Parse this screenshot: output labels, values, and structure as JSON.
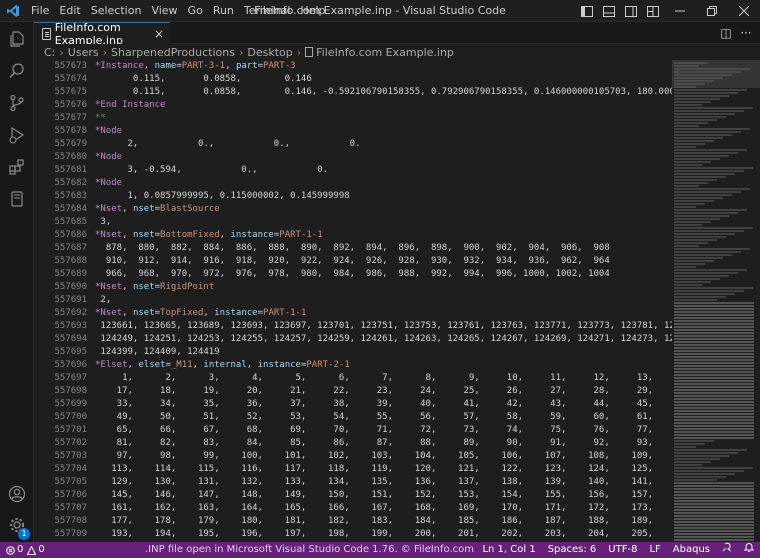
{
  "window": {
    "title": "FileInfo.com Example.inp - Visual Studio Code"
  },
  "menu": [
    "File",
    "Edit",
    "Selection",
    "View",
    "Go",
    "Run",
    "Terminal",
    "Help"
  ],
  "tab": {
    "label": "FileInfo.com Example.inp",
    "close": "×"
  },
  "tab_actions": {
    "split": "◫",
    "more": "···"
  },
  "breadcrumb": [
    "C:",
    "Users",
    "SharpenedProductions",
    "Desktop",
    "FileInfo.com Example.inp"
  ],
  "editor": {
    "lines": [
      {
        "n": "557673",
        "segs": [
          [
            "kw",
            "*Instance"
          ],
          [
            "t",
            ", "
          ],
          [
            "prm",
            "name"
          ],
          [
            "t",
            "="
          ],
          [
            "val",
            "PART-3-1"
          ],
          [
            "t",
            ", "
          ],
          [
            "prm",
            "part"
          ],
          [
            "t",
            "="
          ],
          [
            "val",
            "PART-3"
          ]
        ]
      },
      {
        "n": "557674",
        "segs": [
          [
            "t",
            "       0.115,       0.0858,        0.146"
          ]
        ]
      },
      {
        "n": "557675",
        "segs": [
          [
            "t",
            "       0.115,       0.0858,        0.146, -0.592106790158355, 0.792906790158355, 0.146000000105703, 180.000000"
          ]
        ]
      },
      {
        "n": "557676",
        "segs": [
          [
            "kw",
            "*End Instance"
          ]
        ]
      },
      {
        "n": "557677",
        "segs": [
          [
            "cmt",
            "**"
          ]
        ]
      },
      {
        "n": "557678",
        "segs": [
          [
            "kw",
            "*Node"
          ]
        ]
      },
      {
        "n": "557679",
        "segs": [
          [
            "t",
            "      2,           0.,           0.,           0."
          ]
        ]
      },
      {
        "n": "557680",
        "segs": [
          [
            "kw",
            "*Node"
          ]
        ]
      },
      {
        "n": "557681",
        "segs": [
          [
            "t",
            "      3, -0.594,           0.,           0."
          ]
        ]
      },
      {
        "n": "557682",
        "segs": [
          [
            "kw",
            "*Node"
          ]
        ]
      },
      {
        "n": "557683",
        "segs": [
          [
            "t",
            "      1, 0.0857999995, 0.115000002, 0.145999998"
          ]
        ]
      },
      {
        "n": "557684",
        "segs": [
          [
            "kw",
            "*Nset"
          ],
          [
            "t",
            ", "
          ],
          [
            "prm",
            "nset"
          ],
          [
            "t",
            "="
          ],
          [
            "val",
            "BlastSource"
          ]
        ]
      },
      {
        "n": "557685",
        "segs": [
          [
            "t",
            " 3,"
          ]
        ]
      },
      {
        "n": "557686",
        "segs": [
          [
            "kw",
            "*Nset"
          ],
          [
            "t",
            ", "
          ],
          [
            "prm",
            "nset"
          ],
          [
            "t",
            "="
          ],
          [
            "val",
            "BottomFixed"
          ],
          [
            "t",
            ", "
          ],
          [
            "prm",
            "instance"
          ],
          [
            "t",
            "="
          ],
          [
            "val",
            "PART-1-1"
          ]
        ]
      },
      {
        "n": "557687",
        "segs": [
          [
            "t",
            "  878,  880,  882,  884,  886,  888,  890,  892,  894,  896,  898,  900,  902,  904,  906,  908"
          ]
        ]
      },
      {
        "n": "557688",
        "segs": [
          [
            "t",
            "  910,  912,  914,  916,  918,  920,  922,  924,  926,  928,  930,  932,  934,  936,  962,  964"
          ]
        ]
      },
      {
        "n": "557689",
        "segs": [
          [
            "t",
            "  966,  968,  970,  972,  976,  978,  980,  984,  986,  988,  992,  994,  996, 1000, 1002, 1004"
          ]
        ]
      },
      {
        "n": "557690",
        "segs": [
          [
            "kw",
            "*Nset"
          ],
          [
            "t",
            ", "
          ],
          [
            "prm",
            "nset"
          ],
          [
            "t",
            "="
          ],
          [
            "val",
            "RigidPoint"
          ]
        ]
      },
      {
        "n": "557691",
        "segs": [
          [
            "t",
            " 2,"
          ]
        ]
      },
      {
        "n": "557692",
        "segs": [
          [
            "kw",
            "*Nset"
          ],
          [
            "t",
            ", "
          ],
          [
            "prm",
            "nset"
          ],
          [
            "t",
            "="
          ],
          [
            "val",
            "TopFixed"
          ],
          [
            "t",
            ", "
          ],
          [
            "prm",
            "instance"
          ],
          [
            "t",
            "="
          ],
          [
            "val",
            "PART-1-1"
          ]
        ]
      },
      {
        "n": "557693",
        "segs": [
          [
            "t",
            " 123661, 123665, 123689, 123693, 123697, 123701, 123751, 123753, 123761, 123763, 123771, 123773, 123781, 12378"
          ]
        ]
      },
      {
        "n": "557694",
        "segs": [
          [
            "t",
            " 124249, 124251, 124253, 124255, 124257, 124259, 124261, 124263, 124265, 124267, 124269, 124271, 124273, 12427"
          ]
        ]
      },
      {
        "n": "557695",
        "segs": [
          [
            "t",
            " 124399, 124409, 124419"
          ]
        ]
      },
      {
        "n": "557696",
        "segs": [
          [
            "kw",
            "*Elset"
          ],
          [
            "t",
            ", "
          ],
          [
            "prm",
            "elset"
          ],
          [
            "t",
            "="
          ],
          [
            "val",
            "_M11"
          ],
          [
            "t",
            ", "
          ],
          [
            "prm",
            "internal"
          ],
          [
            "t",
            ", "
          ],
          [
            "prm",
            "instance"
          ],
          [
            "t",
            "="
          ],
          [
            "val",
            "PART-2-1"
          ]
        ]
      },
      {
        "n": "557697",
        "segs": [
          [
            "t",
            "     1,      2,      3,      4,      5,      6,      7,      8,      9,     10,     11,     12,     13,     14,     15,"
          ]
        ]
      },
      {
        "n": "557698",
        "segs": [
          [
            "t",
            "    17,     18,     19,     20,     21,     22,     23,     24,     25,     26,     27,     28,     29,     30,     31,"
          ]
        ]
      },
      {
        "n": "557699",
        "segs": [
          [
            "t",
            "    33,     34,     35,     36,     37,     38,     39,     40,     41,     42,     43,     44,     45,     46,     47,"
          ]
        ]
      },
      {
        "n": "557700",
        "segs": [
          [
            "t",
            "    49,     50,     51,     52,     53,     54,     55,     56,     57,     58,     59,     60,     61,     62,     63,"
          ]
        ]
      },
      {
        "n": "557701",
        "segs": [
          [
            "t",
            "    65,     66,     67,     68,     69,     70,     71,     72,     73,     74,     75,     76,     77,     78,     79,"
          ]
        ]
      },
      {
        "n": "557702",
        "segs": [
          [
            "t",
            "    81,     82,     83,     84,     85,     86,     87,     88,     89,     90,     91,     92,     93,     94,     95,"
          ]
        ]
      },
      {
        "n": "557703",
        "segs": [
          [
            "t",
            "    97,     98,     99,    100,    101,    102,    103,    104,    105,    106,    107,    108,    109,    110,    111,"
          ]
        ]
      },
      {
        "n": "557704",
        "segs": [
          [
            "t",
            "   113,    114,    115,    116,    117,    118,    119,    120,    121,    122,    123,    124,    125,    126,    127,"
          ]
        ]
      },
      {
        "n": "557705",
        "segs": [
          [
            "t",
            "   129,    130,    131,    132,    133,    134,    135,    136,    137,    138,    139,    140,    141,    142,    143,"
          ]
        ]
      },
      {
        "n": "557706",
        "segs": [
          [
            "t",
            "   145,    146,    147,    148,    149,    150,    151,    152,    153,    154,    155,    156,    157,    158,    159,"
          ]
        ]
      },
      {
        "n": "557707",
        "segs": [
          [
            "t",
            "   161,    162,    163,    164,    165,    166,    167,    168,    169,    170,    171,    172,    173,    174,    175,"
          ]
        ]
      },
      {
        "n": "557708",
        "segs": [
          [
            "t",
            "   177,    178,    179,    180,    181,    182,    183,    184,    185,    186,    187,    188,    189,    190,    191,"
          ]
        ]
      },
      {
        "n": "557709",
        "segs": [
          [
            "t",
            "   193,    194,    195,    196,    197,    198,    199,    200,    201,    202,    203,    204,    205,    206,    207,"
          ]
        ]
      }
    ]
  },
  "status": {
    "errors": "0",
    "warnings": "0",
    "caption": ".INP file open in Microsoft Visual Studio Code 1.76. © FileInfo.com",
    "position": "Ln 1, Col 1",
    "spaces": "Spaces: 6",
    "encoding": "UTF-8",
    "eol": "LF",
    "language": "Abaqus"
  },
  "accounts_badge": "1",
  "colors": {
    "status_bg": "#68217a",
    "accent": "#0078d4",
    "keyword": "#c586c0",
    "param": "#9cdcfe",
    "value": "#ce9178",
    "comment": "#6a9955"
  }
}
